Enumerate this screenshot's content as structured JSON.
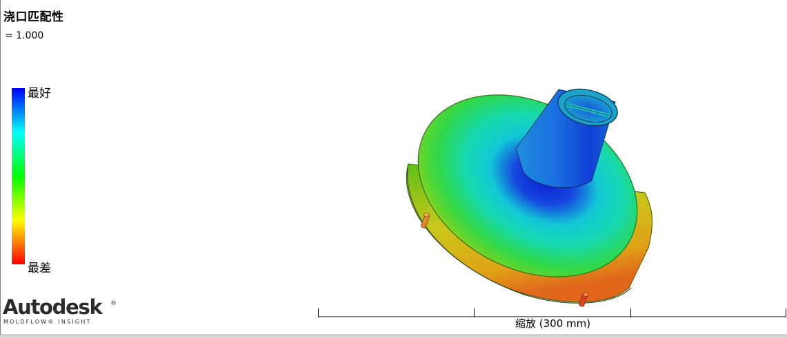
{
  "result": {
    "title": "浇口匹配性",
    "value": "= 1.000"
  },
  "legend": {
    "top_label": "最好",
    "bottom_label": "最差",
    "colors": [
      "#0000ff",
      "#00ffff",
      "#00ff00",
      "#ffff00",
      "#ff0000"
    ]
  },
  "branding": {
    "logo_text": "Autodesk",
    "logo_mark": "®",
    "product_text": "MOLDFLOW® INSIGHT"
  },
  "scale": {
    "label": "缩放 (300 mm)"
  },
  "model": {
    "icon": "gate-model-icon"
  }
}
